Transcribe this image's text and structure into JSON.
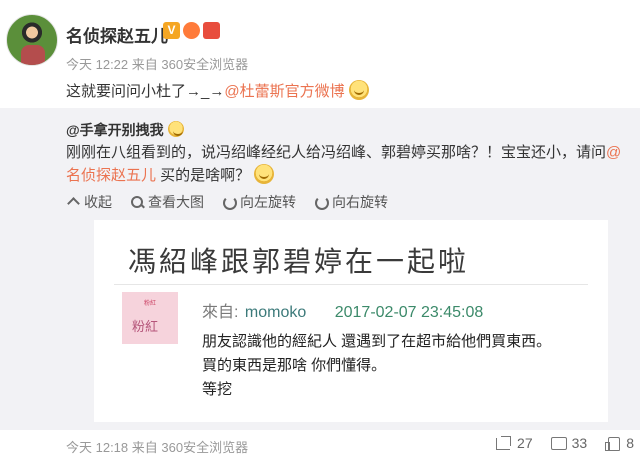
{
  "post": {
    "username": "名侦探赵五儿",
    "time": "今天 12:22",
    "source": "来自 360安全浏览器",
    "text_prefix": "这就要问问小杜了→_→",
    "mention": "@杜蕾斯官方微博"
  },
  "repost": {
    "username": "@手拿开别拽我",
    "text_prefix": "刚刚在八组看到的，说冯绍峰经纪人给冯绍峰、郭碧婷买那啥？！宝宝还小，请问",
    "mention": "@名侦探赵五儿",
    "text_suffix": " 买的是啥啊？",
    "actions": {
      "collapse": "收起",
      "view_large": "查看大图",
      "rotate_left": "向左旋转",
      "rotate_right": "向右旋转"
    },
    "image": {
      "title": "馮紹峰跟郭碧婷在一起啦",
      "avatar_small": "粉紅",
      "avatar_label": "粉紅",
      "from_label": "來自:",
      "from_user": "momoko",
      "date": "2017-02-07 23:45:08",
      "body_line1": "朋友認識他的經紀人 還遇到了在超市給他們買東西。",
      "body_line2": "買的東西是那啥 你們懂得。",
      "body_line3": "等挖"
    }
  },
  "footer": {
    "time": "今天 12:18",
    "source": "来自 360安全浏览器",
    "shares": "27",
    "comments": "33",
    "likes": "8"
  },
  "icons": {
    "verified": "verified-badge-icon",
    "emoji": "smile-emoji-icon"
  },
  "colors": {
    "mention": "#eb7350",
    "repost_bg": "#f2f2f5",
    "meta": "#999999"
  }
}
